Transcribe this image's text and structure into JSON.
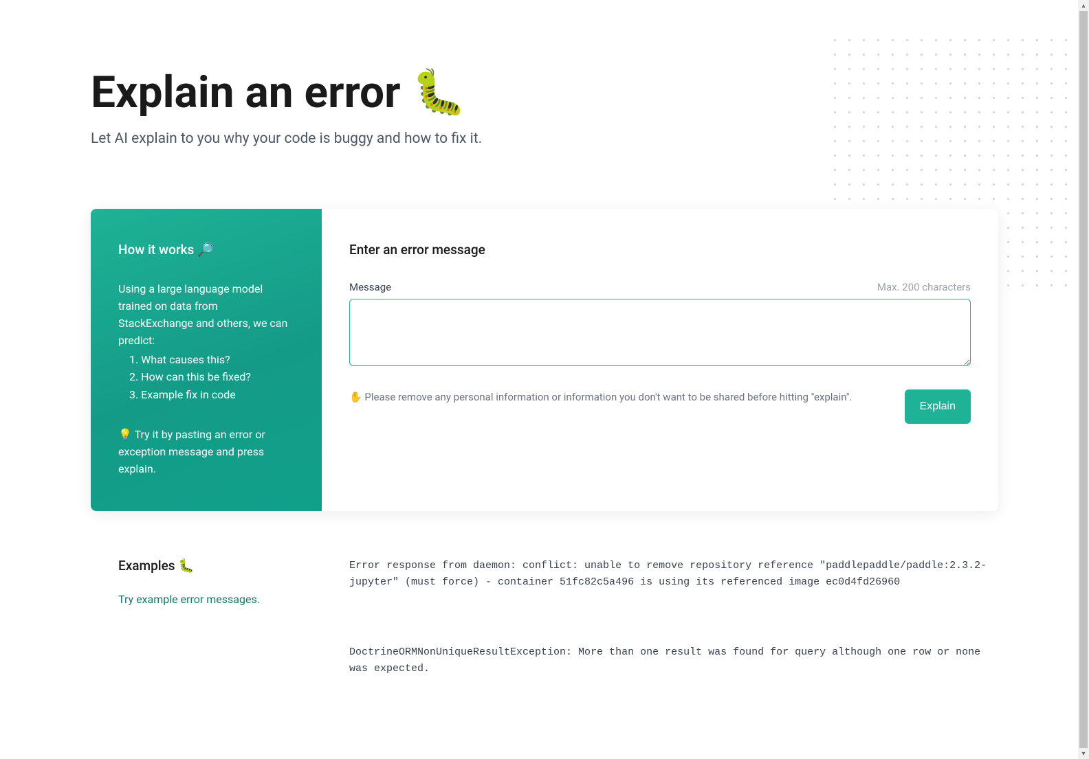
{
  "header": {
    "title": "Explain an error",
    "title_emoji": "🐛",
    "subtitle": "Let AI explain to you why your code is buggy and how to fix it."
  },
  "how_it_works": {
    "title": "How it works 🔎",
    "description": "Using a large language model trained on data from StackExchange and others, we can predict:",
    "items": [
      "1. What causes this?",
      "2. How can this be fixed?",
      "3. Example fix in code"
    ],
    "tip": "💡 Try it by pasting an error or exception message and press explain."
  },
  "form": {
    "title": "Enter an error message",
    "message_label": "Message",
    "max_chars": "Max. 200 characters",
    "textarea_value": "",
    "privacy_note": "✋ Please remove any personal information or information you don't want to be shared before hitting \"explain\".",
    "button_label": "Explain"
  },
  "examples": {
    "title": "Examples 🐛",
    "subtitle": "Try example error messages.",
    "items": [
      "Error response from daemon: conflict: unable to remove repository reference \"paddlepaddle/paddle:2.3.2-jupyter\" (must force) - container 51fc82c5a496 is using its referenced image ec0d4fd26960",
      "DoctrineORMNonUniqueResultException: More than one result was found for query although one row or none was expected."
    ]
  },
  "colors": {
    "accent": "#1eb296"
  }
}
